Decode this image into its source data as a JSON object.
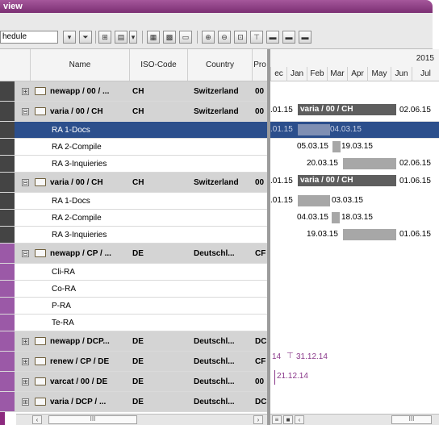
{
  "window": {
    "title": "view"
  },
  "toolbar": {
    "view_select_value": "hedule"
  },
  "grid": {
    "columns": [
      "Name",
      "ISO-Code",
      "Country",
      "Pro"
    ],
    "rows": [
      {
        "type": "group",
        "expander": "⊞",
        "name": "newapp / 00 / ...",
        "iso": "CH",
        "country": "Switzerland",
        "pro": "00"
      },
      {
        "type": "group",
        "expander": "⊟",
        "name": "varia / 00 / CH",
        "iso": "CH",
        "country": "Switzerland",
        "pro": "00"
      },
      {
        "type": "child",
        "name": "RA 1-Docs",
        "selected": true
      },
      {
        "type": "child",
        "name": "RA 2-Compile"
      },
      {
        "type": "child",
        "name": "RA 3-Inquieries"
      },
      {
        "type": "group",
        "expander": "⊟",
        "name": "varia / 00 / CH",
        "iso": "CH",
        "country": "Switzerland",
        "pro": "00"
      },
      {
        "type": "child",
        "name": "RA 1-Docs"
      },
      {
        "type": "child",
        "name": "RA 2-Compile"
      },
      {
        "type": "child",
        "name": "RA 3-Inquieries"
      },
      {
        "type": "group",
        "expander": "⊟",
        "name": "newapp / CP / ...",
        "iso": "DE",
        "country": "Deutschl...",
        "pro": "CF"
      },
      {
        "type": "child",
        "name": "Cli-RA"
      },
      {
        "type": "child",
        "name": "Co-RA"
      },
      {
        "type": "child",
        "name": "P-RA"
      },
      {
        "type": "child",
        "name": "Te-RA"
      },
      {
        "type": "group",
        "expander": "⊞",
        "name": "newapp / DCP...",
        "iso": "DE",
        "country": "Deutschl...",
        "pro": "DC"
      },
      {
        "type": "group",
        "expander": "⊞",
        "name": "renew / CP / DE",
        "iso": "DE",
        "country": "Deutschl...",
        "pro": "CF"
      },
      {
        "type": "group",
        "expander": "⊞",
        "name": "varcat / 00 / DE",
        "iso": "DE",
        "country": "Deutschl...",
        "pro": "00"
      },
      {
        "type": "group",
        "expander": "⊞",
        "name": "varia / DCP / ...",
        "iso": "DE",
        "country": "Deutschl...",
        "pro": "DC"
      }
    ]
  },
  "timeline": {
    "year": "2015",
    "months": [
      "ec",
      "Jan",
      "Feb",
      "Mar",
      "Apr",
      "May",
      "Jun",
      "Jul"
    ],
    "labels": {
      "g1_start": ".01.15",
      "g1_name": "varia / 00 / CH",
      "g1_end": "02.06.15",
      "r1_start": ".01.15",
      "r1_end": "04.03.15",
      "r2_start": "05.03.15",
      "r2_end": "19.03.15",
      "r3_start": "20.03.15",
      "r3_end": "02.06.15",
      "g2_start": ".01.15",
      "g2_name": "varia / 00 / CH",
      "g2_end": "01.06.15",
      "s1_start": ".01.15",
      "s1_end": "03.03.15",
      "s2_start": "04.03.15",
      "s2_end": "18.03.15",
      "s3_start": "19.03.15",
      "s3_end": "01.06.15",
      "renew_left": "14",
      "renew_date": "31.12.14",
      "varcat_date": "21.12.14"
    }
  },
  "scrollbars": {
    "thumb_label": "III"
  }
}
